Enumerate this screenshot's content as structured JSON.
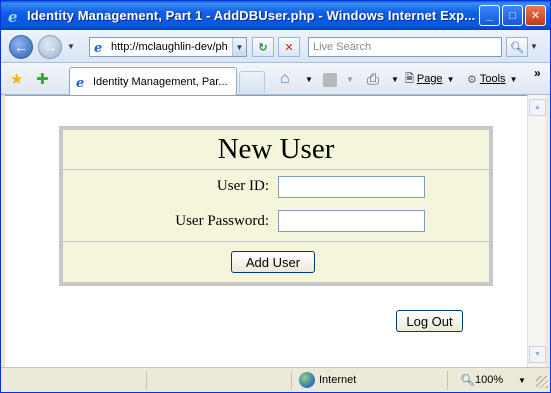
{
  "window": {
    "title": "Identity Management, Part 1 - AddDBUser.php - Windows Internet Exp..."
  },
  "nav": {
    "address_url": "http://mclaughlin-dev/ph",
    "search_placeholder": "Live Search"
  },
  "tabs": [
    {
      "label": "Identity Management, Par..."
    }
  ],
  "commands": {
    "page_label": "Page",
    "tools_label": "Tools"
  },
  "form": {
    "title": "New User",
    "user_id_label": "User ID:",
    "user_id_value": "",
    "password_label": "User Password:",
    "password_value": "",
    "add_button": "Add User"
  },
  "logout_button": "Log Out",
  "status": {
    "zone": "Internet",
    "zoom": "100%"
  },
  "colors": {
    "form_background": "#f5f5dc",
    "form_border": "#c8c8c8",
    "titlebar": "#0558e0"
  }
}
